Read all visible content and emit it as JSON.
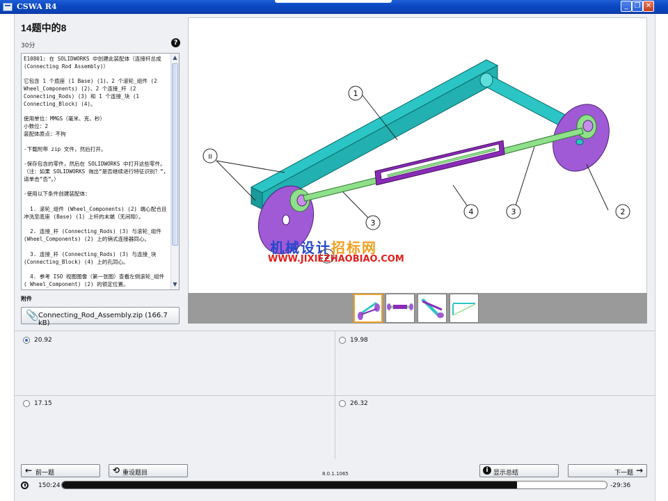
{
  "window": {
    "title": "CSWA R4",
    "buttons": {
      "minimize": "_",
      "restore": "❐",
      "close": "✕"
    }
  },
  "question": {
    "title": "14题中的8",
    "points": "30分",
    "help": "?",
    "text": "E10801: 在 SOLIDWORKS 中创建此装配体（连接杆总成 (Connecting Rod Assembly)）\n\n它包含 1 个底座 (1 Base) (1)、2 个滚轮_组件 (2 Wheel_Components) (2)、2 个连接_杆 (2 Connecting_Rods) (3) 和 1 个连接_块 (1 Connecting_Block) (4)。\n\n使用单位：MMGS（毫米、克、秒）\n小数位：2\n装配体原点：不拘\n\n-下载附带 zip 文件，然后打开。\n\n-保存包含的零件，然后在 SOLIDWORKS 中打开这些零件。（注：如果 SOLIDWORKS 询出“是否继续进行特征识别？”，请单击“否”。）\n\n-使用以下条件创建装配体：\n\n  1. 滚轮_组件 (Wheel_Components) (2) 端心配合且冲洗至底座 (Base) (1) 上杆的末端（无间隙）。\n\n  2. 连接_杆 (Connecting_Rods) (3) 与滚轮_组件 (Wheel_Components) (2) 上的销式连接器同心。\n\n  3. 连接_杆 (Connecting_Rods) (3) 与连接_块 (Connecting_Block) (4) 上的孔同心。\n\n  4. 参考 ISO 视图图像（第一张图）查看左侧滚轮_组件 ( Wheel_Component) (2) 的锁定位置。"
  },
  "attachment": {
    "label": "附件",
    "file": "Connecting_Rod_Assembly.zip (166.7 kB)"
  },
  "figure": {
    "callouts": [
      "1",
      "2",
      "3",
      "4",
      "3",
      "2",
      "II"
    ],
    "thumbnails": [
      "iso-view",
      "front-view",
      "top-view",
      "side-view"
    ],
    "selected_thumbnail": "iso-view",
    "colors": {
      "base": "#2bc5c5",
      "wheel": "#a05ad6",
      "rod": "#8fe08a",
      "block": "#8a2bb8"
    }
  },
  "watermark": {
    "line1a": "机械设计",
    "line1b": "招标网",
    "line2": "WWW.JIXIEZHAOBIAO.COM"
  },
  "answers": {
    "options": [
      "20.92",
      "19.98",
      "17.15",
      "26.32"
    ],
    "selected": "20.92"
  },
  "nav": {
    "prev": "前一题",
    "reset": "重设题目",
    "version": "8.0.1.1065",
    "summary": "显示总结",
    "next": "下一题"
  },
  "timer": {
    "elapsed": "150:24",
    "remaining": "-29:36",
    "progress": 0.835
  }
}
